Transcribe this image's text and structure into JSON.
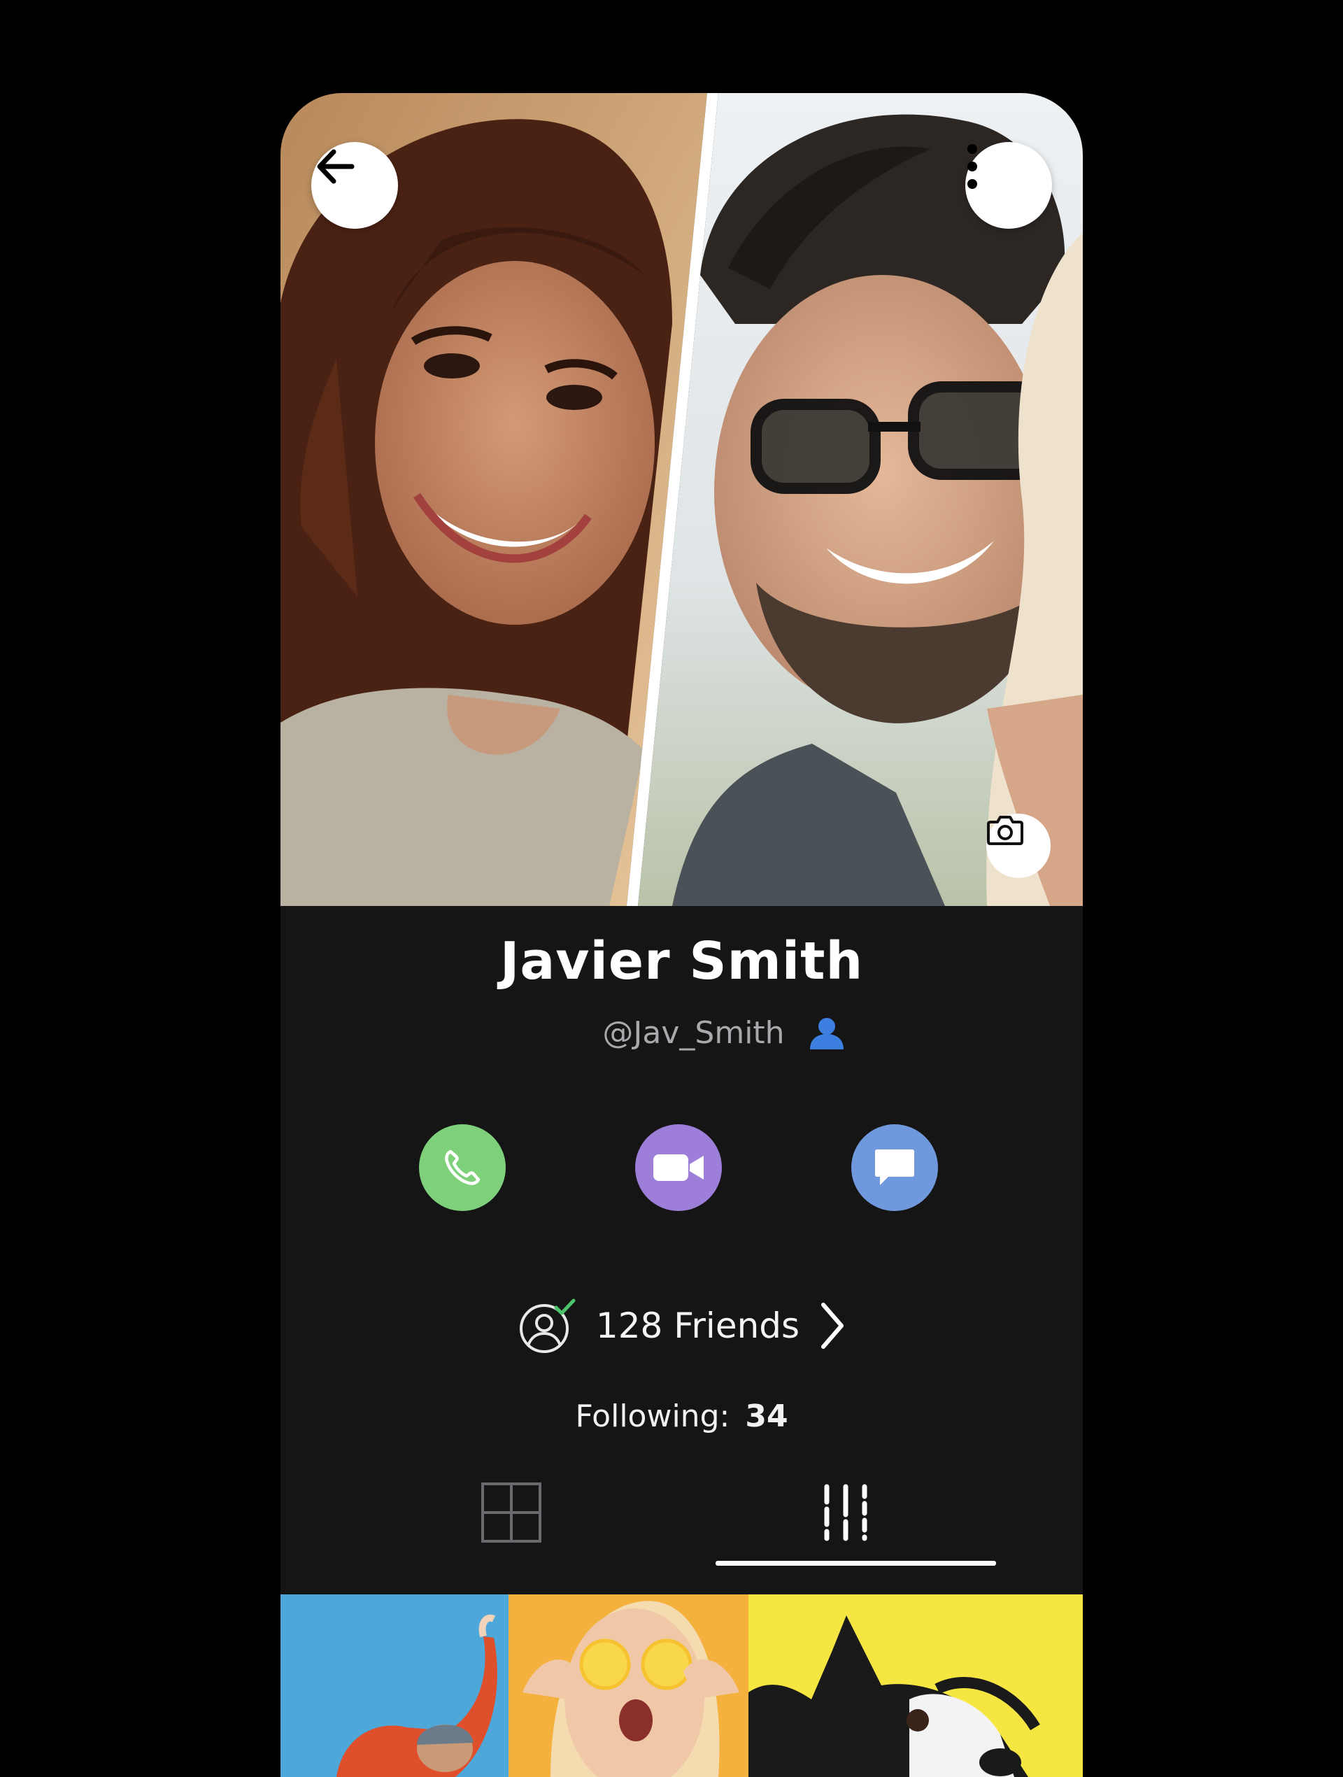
{
  "profile": {
    "name": "Javier Smith",
    "handle": "@Jav_Smith"
  },
  "friends": {
    "label": "128 Friends"
  },
  "following": {
    "label": "Following:",
    "count": "34"
  },
  "actions": {
    "call_color": "#7ed07b",
    "video_color": "#9d7ed9",
    "message_color": "#6f99dc"
  },
  "colors": {
    "background": "#000000",
    "panel": "#151516",
    "accent_blue": "#3d7fe0",
    "check_green": "#4cc26a"
  },
  "tabs": [
    "grid-tab",
    "list-tab"
  ],
  "active_tab": "list-tab"
}
